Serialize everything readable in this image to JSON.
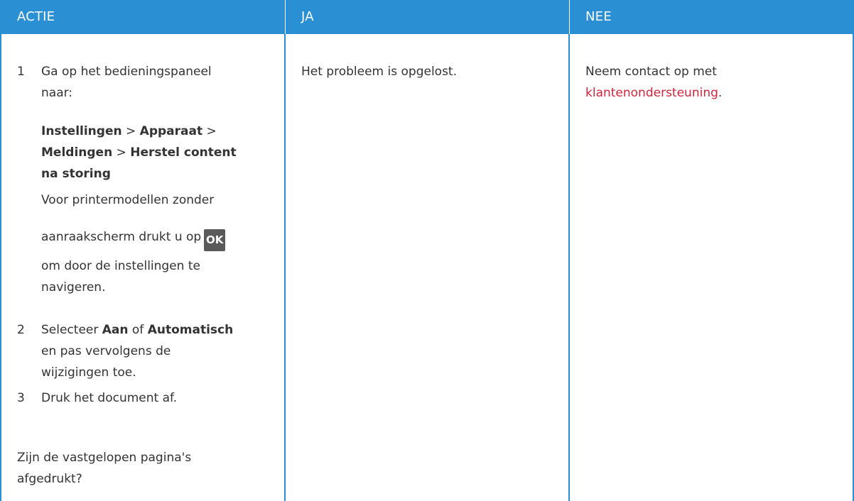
{
  "headers": {
    "action": "ACTIE",
    "yes": "JA",
    "no": "NEE"
  },
  "action": {
    "step1": {
      "num": "1",
      "line1": "Ga op het bedieningspaneel",
      "line2": "naar:",
      "path": [
        "Instellingen",
        "Apparaat",
        "Meldingen",
        "Herstel content",
        "na storing"
      ],
      "separator": ">",
      "note_line1": "Voor printermodellen zonder",
      "note_line2": "aanraakscherm drukt u op",
      "ok_icon_label": "OK",
      "note_line3": "om door de instellingen te",
      "note_line4": "navigeren."
    },
    "step2": {
      "num": "2",
      "select": "Selecteer",
      "on": "Aan",
      "or": "of",
      "auto": "Automatisch",
      "line2": "en pas vervolgens de",
      "line3": "wijzigingen toe."
    },
    "step3": {
      "num": "3",
      "text": "Druk het document af."
    },
    "question_line1": "Zijn de vastgelopen pagina's",
    "question_line2": "afgedrukt?"
  },
  "yes": {
    "text": "Het probleem is opgelost."
  },
  "no": {
    "line1": "Neem contact op met",
    "link": "klantenondersteuning",
    "period": "."
  },
  "colors": {
    "header_bg": "#2a8fd3",
    "link": "#d0253c",
    "text": "#333333"
  }
}
